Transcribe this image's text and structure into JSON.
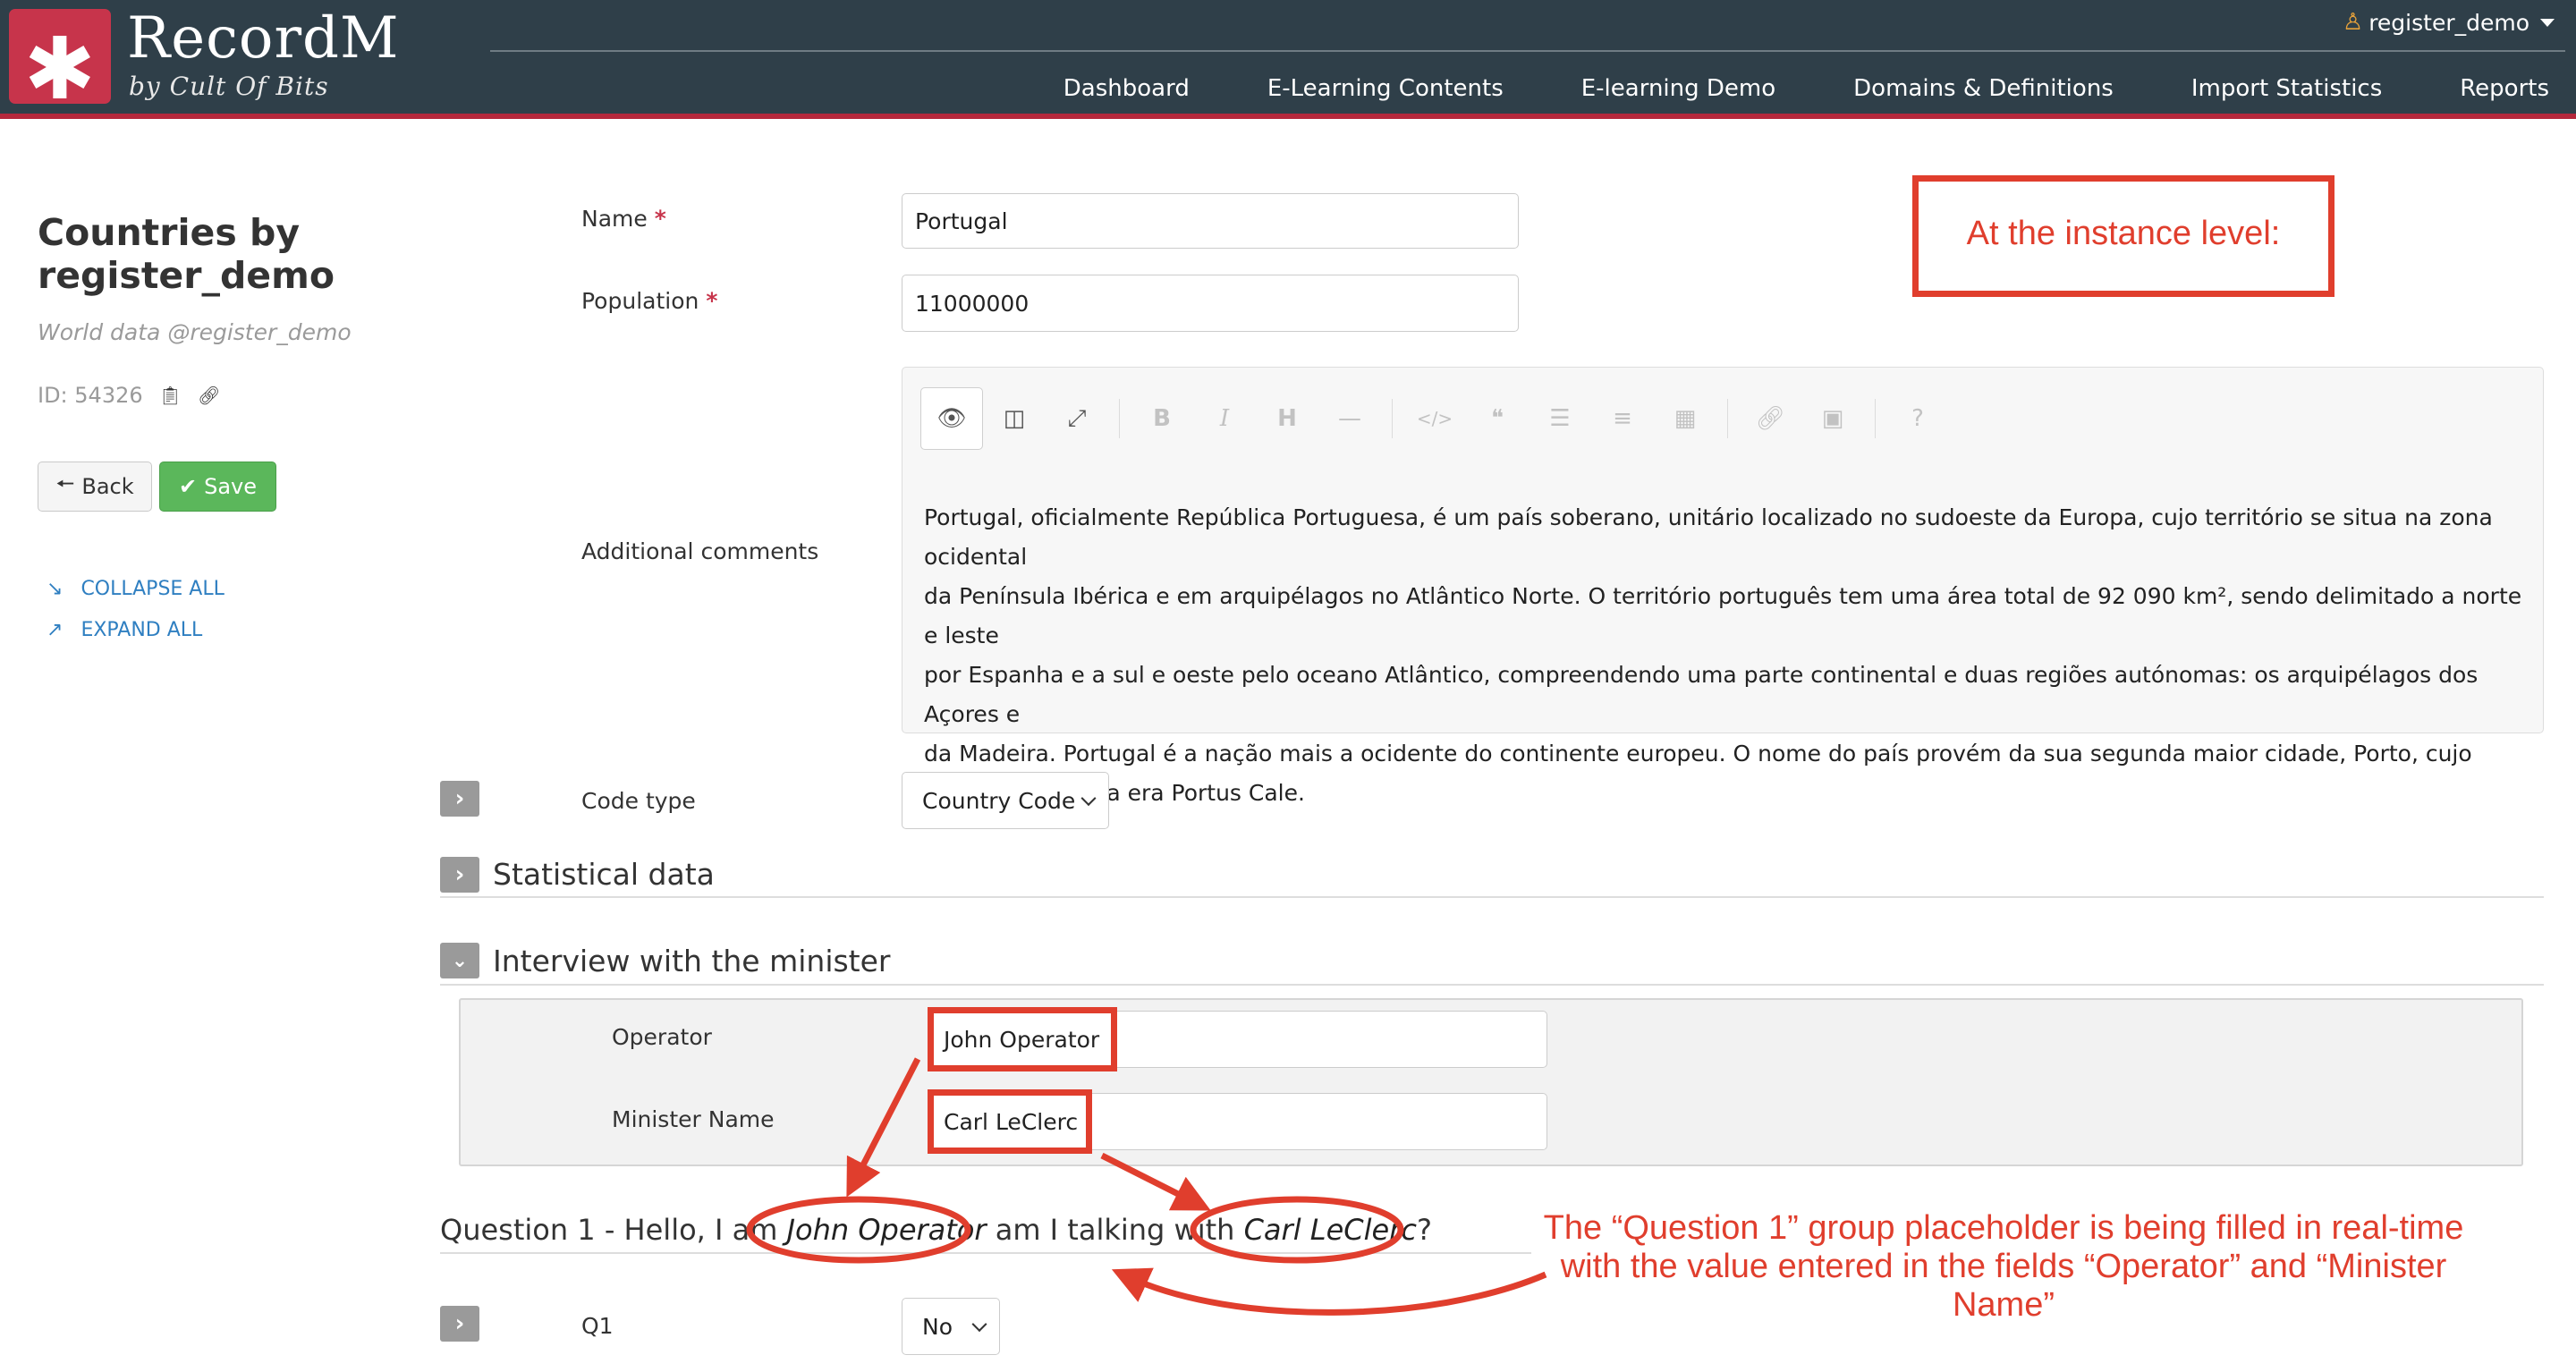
{
  "app": {
    "name": "RecordM",
    "byline": "by Cult Of Bits",
    "logo_glyph": "✱",
    "user": "register_demo"
  },
  "nav": [
    "Dashboard",
    "E-Learning Contents",
    "E-learning Demo",
    "Domains & Definitions",
    "Import Statistics",
    "Reports"
  ],
  "sidebar": {
    "title": "Countries by register_demo",
    "subtitle": "World data @register_demo",
    "id_text": "ID: 54326",
    "back_label": "Back",
    "save_label": "Save",
    "collapse_all": "COLLAPSE ALL",
    "expand_all": "EXPAND ALL"
  },
  "form": {
    "name_label": "Name",
    "name_value": "Portugal",
    "population_label": "Population",
    "population_value": "11000000",
    "required_mark": "*",
    "comments_label": "Additional comments",
    "comments_lines": [
      "Portugal, oficialmente República Portuguesa, é um país soberano, unitário localizado no sudoeste da Europa, cujo território se situa na zona ocidental",
      "da Península Ibérica e em arquipélagos no Atlântico Norte. O território português tem uma área total de 92 090 km², sendo delimitado a norte e leste",
      "por Espanha e a sul e oeste pelo oceano Atlântico, compreendendo uma parte continental e duas regiões autónomas: os arquipélagos dos Açores e",
      "da Madeira. Portugal é a nação mais a ocidente do continente europeu. O nome do país provém da sua segunda maior cidade, Porto, cujo",
      "nome latino-celta era Portus Cale."
    ],
    "code_type_label": "Code type",
    "code_type_value": "Country Code",
    "statistical_title": "Statistical data",
    "interview_title": "Interview with the minister",
    "operator_label": "Operator",
    "operator_value": "John Operator",
    "minister_label": "Minister Name",
    "minister_value": "Carl LeClerc",
    "question_prefix": "Question 1 - Hello, I am ",
    "question_operator": "John Operator",
    "question_mid": " am I talking with ",
    "question_minister": "Carl LeClerc",
    "question_suffix": "?",
    "q1_label": "Q1",
    "q1_value": "No"
  },
  "annotations": {
    "instance_level": "At the instance level:",
    "explanation_lines": [
      "The “Question 1” group placeholder is being filled in real-time",
      "with the value entered in the fields “Operator” and “Minister",
      "Name”"
    ]
  },
  "colors": {
    "topbar": "#2f3f49",
    "brand_red": "#c7344b",
    "annotation_red": "#e03e2d",
    "save_green": "#5bb75b",
    "link_blue": "#2f7fc1"
  }
}
